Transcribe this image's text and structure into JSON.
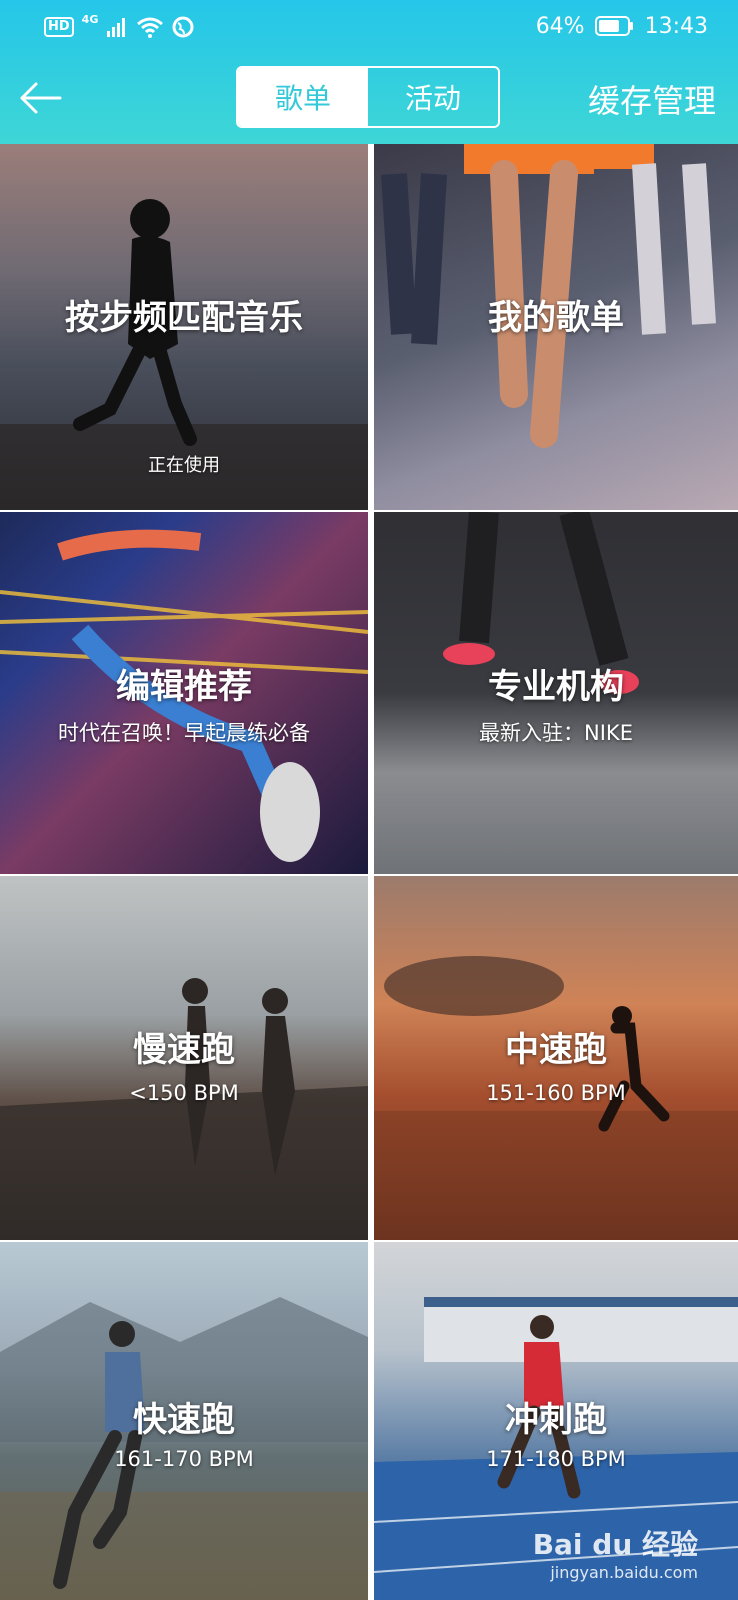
{
  "status": {
    "network": "4G",
    "hd_badge": "HD",
    "battery": "64%",
    "time": "13:43"
  },
  "nav": {
    "tabs": [
      {
        "label": "歌单",
        "active": true
      },
      {
        "label": "活动",
        "active": false
      }
    ],
    "cache_label": "缓存管理"
  },
  "tiles": [
    {
      "title": "按步频匹配音乐",
      "subtitle": "正在使用"
    },
    {
      "title": "我的歌单",
      "subtitle": ""
    },
    {
      "title": "编辑推荐",
      "subtitle": "时代在召唤！早起晨练必备"
    },
    {
      "title": "专业机构",
      "subtitle": "最新入驻：NIKE"
    },
    {
      "title": "慢速跑",
      "subtitle": "<150 BPM"
    },
    {
      "title": "中速跑",
      "subtitle": "151-160 BPM"
    },
    {
      "title": "快速跑",
      "subtitle": "161-170 BPM"
    },
    {
      "title": "冲刺跑",
      "subtitle": "171-180 BPM"
    }
  ],
  "watermark": {
    "logo": "Bai du 经验",
    "url": "jingyan.baidu.com"
  },
  "colors": {
    "header_top": "#25c6e9",
    "header_bottom": "#3ed6d6",
    "active_tab_text": "#33c9d9"
  }
}
